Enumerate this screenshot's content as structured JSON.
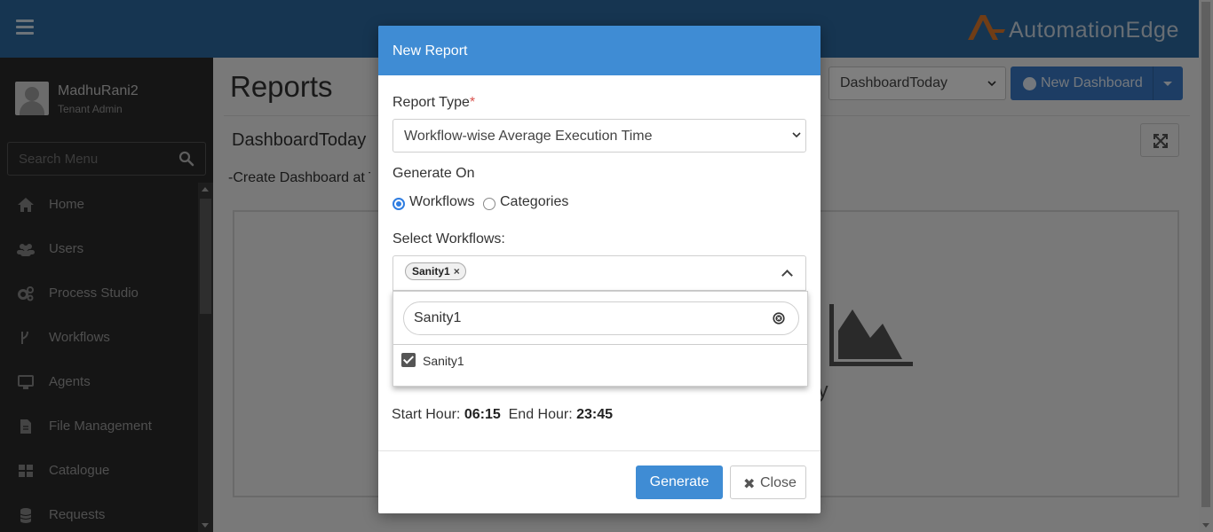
{
  "header": {
    "brand_text": "AutomationEdge"
  },
  "sidebar": {
    "user_name": "MadhuRani2",
    "user_role": "Tenant Admin",
    "search_placeholder": "Search Menu",
    "items": [
      {
        "label": "Home",
        "icon": "home-icon"
      },
      {
        "label": "Users",
        "icon": "users-icon"
      },
      {
        "label": "Process Studio",
        "icon": "gears-icon"
      },
      {
        "label": "Workflows",
        "icon": "workflow-icon"
      },
      {
        "label": "Agents",
        "icon": "monitor-icon"
      },
      {
        "label": "File Management",
        "icon": "file-icon"
      },
      {
        "label": "Catalogue",
        "icon": "grid-icon"
      },
      {
        "label": "Requests",
        "icon": "database-icon"
      }
    ]
  },
  "main": {
    "page_title": "Reports",
    "dashboard_select_value": "DashboardToday",
    "new_dashboard_label": "New Dashboard",
    "panel_title": "DashboardToday",
    "panel_text": "-Create Dashboard at To",
    "chart_caption": "ty"
  },
  "modal": {
    "title": "New Report",
    "report_type_label": "Report Type",
    "report_type_required": "*",
    "report_type_value": "Workflow-wise Average Execution Time",
    "generate_on_label": "Generate On",
    "radio_workflows": "Workflows",
    "radio_categories": "Categories",
    "selected_radio": "Workflows",
    "select_workflows_label": "Select Workflows:",
    "selected_chip": "Sanity1",
    "chip_remove": "×",
    "search_value": "Sanity1",
    "option_label": "Sanity1",
    "option_checked": true,
    "start_hour_label": "Start Hour:",
    "start_hour_value": "06:15",
    "end_hour_label": "End Hour:",
    "end_hour_value": "23:45",
    "generate_label": "Generate",
    "close_label": "Close",
    "close_icon": "✖"
  },
  "colors": {
    "header_bg": "#2d6aa2",
    "sidebar_bg": "#2b2b2b",
    "modal_header": "#3f8cd4",
    "primary_button": "#3f8cd4",
    "brand_orange": "#e07b2c"
  }
}
